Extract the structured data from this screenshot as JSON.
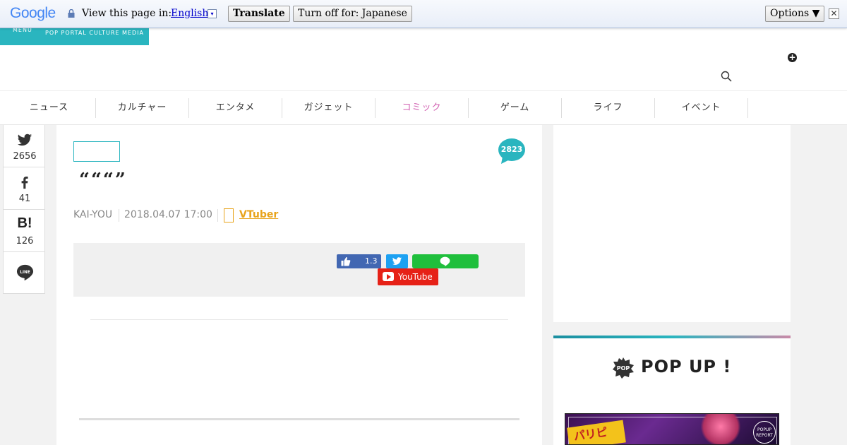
{
  "translate_bar": {
    "logo_text": "Google",
    "view_label": "View this page in:",
    "language": "English",
    "language_caret": "▾",
    "translate_button": "Translate",
    "turn_off_button": "Turn off for: Japanese",
    "options_button": "Options ▼",
    "close_glyph": "✕"
  },
  "header": {
    "menu_label": "MENU",
    "tagline": "POP PORTAL CULTURE MEDIA",
    "plus_glyph": "+",
    "brand_color": "#2ab5bf"
  },
  "nav": {
    "items": [
      {
        "label": "ニュース"
      },
      {
        "label": "カルチャー"
      },
      {
        "label": "エンタメ"
      },
      {
        "label": "ガジェット"
      },
      {
        "label": "コミック"
      },
      {
        "label": "ゲーム"
      },
      {
        "label": "ライフ"
      },
      {
        "label": "イベント"
      }
    ],
    "active_index": 4,
    "active_color": "#d05fb0"
  },
  "share_column": {
    "twitter_count": "2656",
    "facebook_count": "41",
    "hatena_label": "B!",
    "hatena_count": "126"
  },
  "article": {
    "comment_count": "2823",
    "title": "“““”",
    "author": "KAI-YOU",
    "date": "2018.04.07 17:00",
    "tag": "VTuber",
    "tag_color": "#e8a41c"
  },
  "share_panel": {
    "facebook_count": "1.3",
    "youtube_label": "YouTube"
  },
  "sidebar": {
    "pop_badge": "POP",
    "pop_title": "POP UP !",
    "image_sticker": "パリピ",
    "image_mark": "POPUP REPORT"
  }
}
